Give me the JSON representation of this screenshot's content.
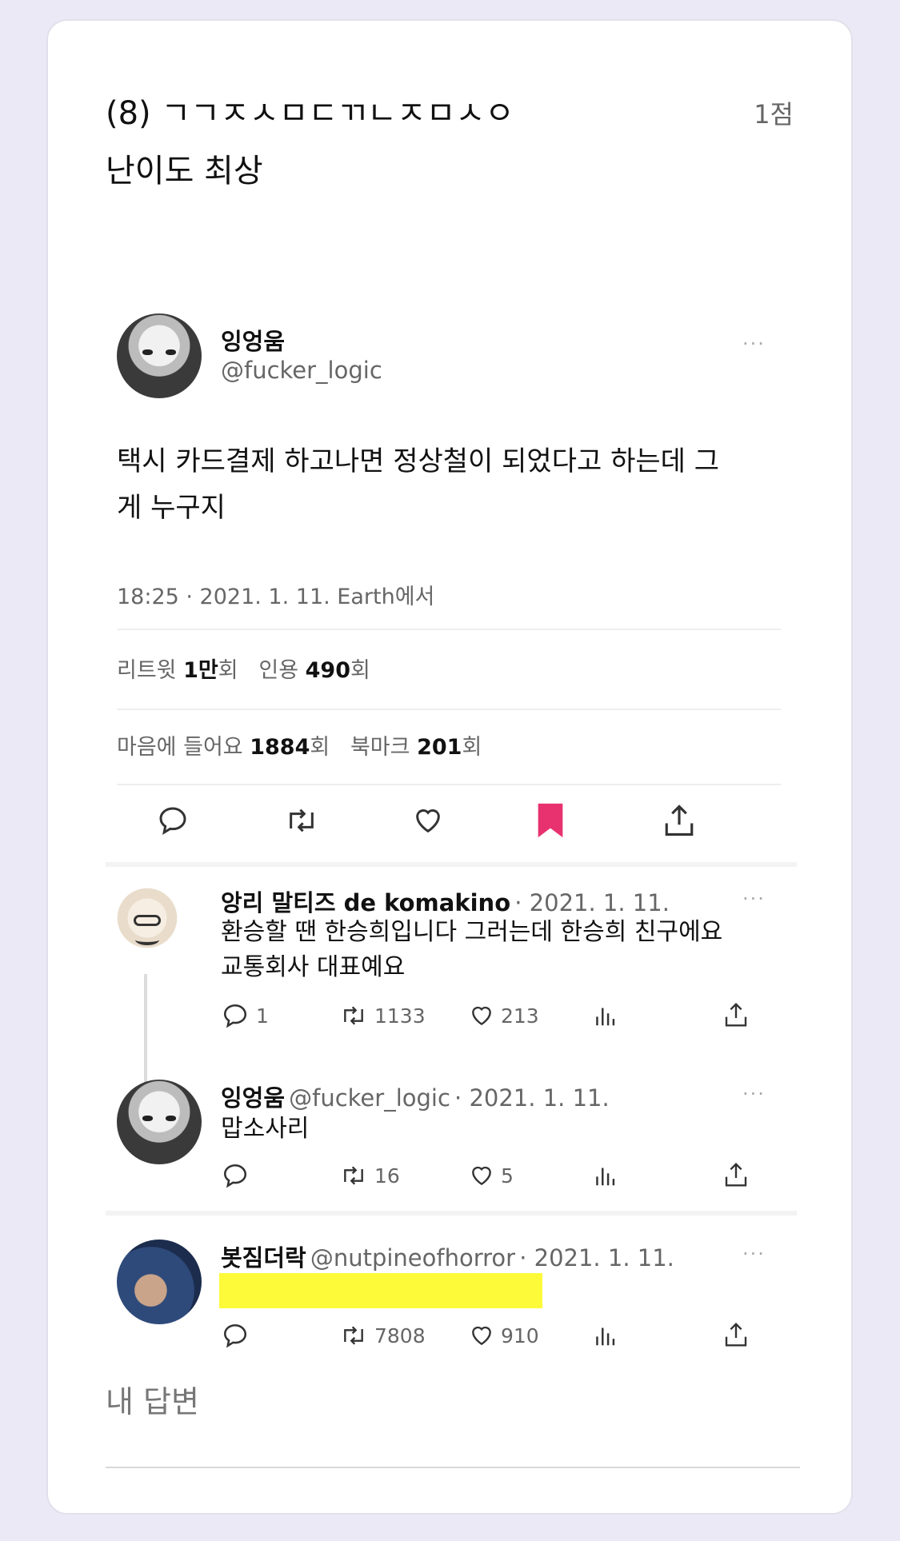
{
  "question": {
    "title": "(8) ㄱㄱㅈㅅㅁㄷㄲㄴㅈㅁㅅㅇ",
    "points": "1점",
    "subtitle": "난이도 최상"
  },
  "tweet": {
    "author_name": "잉엉움",
    "author_handle": "@fucker_logic",
    "more": "···",
    "text_line1": "택시 카드결제 하고나면 정상철이 되었다고 하는데 그",
    "text_line2": "게 누구지",
    "timestamp": "18:25 · 2021. 1. 11. Earth에서",
    "retweets_label": "리트윗",
    "retweets_value": "1만",
    "quotes_label": "인용",
    "quotes_value": "490",
    "likes_label": "마음에 들어요",
    "likes_value": "1884",
    "bookmarks_label": "북마크",
    "bookmarks_value": "201",
    "unit": "회",
    "bookmark_color": "#e8326f"
  },
  "replies": [
    {
      "name": "앙리 말티즈 de komakino",
      "handle": "",
      "date": "· 2021. 1. 11.",
      "text_line1": "환승할 땐 한승희입니다 그러는데 한승희 친구에요",
      "text_line2": "교통회사 대표예요",
      "replies": "1",
      "retweets": "1133",
      "likes": "213"
    },
    {
      "name": "잉엉움",
      "handle": "@fucker_logic",
      "date": "· 2021. 1. 11.",
      "text_line1": "맙소사리",
      "replies": "",
      "retweets": "16",
      "likes": "5"
    },
    {
      "name": "봇짐더락",
      "handle": "@nutpineofhorror",
      "date": "· 2021. 1. 11.",
      "redaction_color": "#fdfa3a",
      "replies": "",
      "retweets": "7808",
      "likes": "910"
    }
  ],
  "answer": {
    "label": "내 답변",
    "value": ""
  }
}
